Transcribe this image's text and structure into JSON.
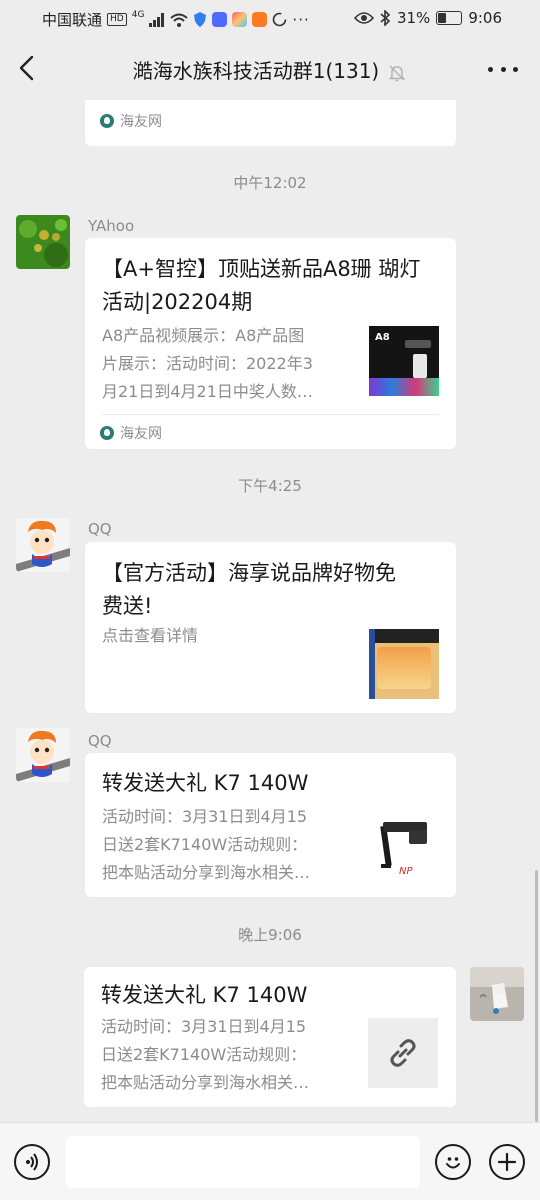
{
  "status_bar": {
    "carrier": "中国联通",
    "hd": "HD",
    "network": "4G",
    "battery": "31%",
    "battery_level": 0.31,
    "time": "9:06"
  },
  "nav": {
    "title": "澔海水族科技活动群1(131)"
  },
  "messages": [
    {
      "source": "海友网"
    },
    {
      "time": "中午12:02"
    },
    {
      "sender": "YAhoo",
      "title_line1": "【A+智控】顶贴送新品A8珊 瑚灯",
      "title_line2": "活动|202204期",
      "desc_line1": "A8产品视频展示：A8产品图",
      "desc_line2": "片展示：活动时间：2022年3",
      "desc_line3": "月21日到4月21日中奖人数…",
      "source": "海友网",
      "thumb_label": "A8"
    },
    {
      "time": "下午4:25"
    },
    {
      "sender": "QQ",
      "title_line1": "【官方活动】海享说品牌好物免",
      "title_line2": "费送!",
      "desc_line1": "点击查看详情"
    },
    {
      "sender": "QQ",
      "title_line1": "转发送大礼 K7 140W",
      "desc_line1": "活动时间：3月31日到4月15",
      "desc_line2": "日送2套K7140W活动规则：",
      "desc_line3": "把本贴活动分享到海水相关…"
    },
    {
      "time": "晚上9:06"
    },
    {
      "title_line1": "转发送大礼 K7 140W",
      "desc_line1": "活动时间：3月31日到4月15",
      "desc_line2": "日送2套K7140W活动规则：",
      "desc_line3": "把本贴活动分享到海水相关…"
    }
  ],
  "colors": {
    "background": "#ededed",
    "card": "#ffffff",
    "muted_text": "#8c8c8c"
  }
}
